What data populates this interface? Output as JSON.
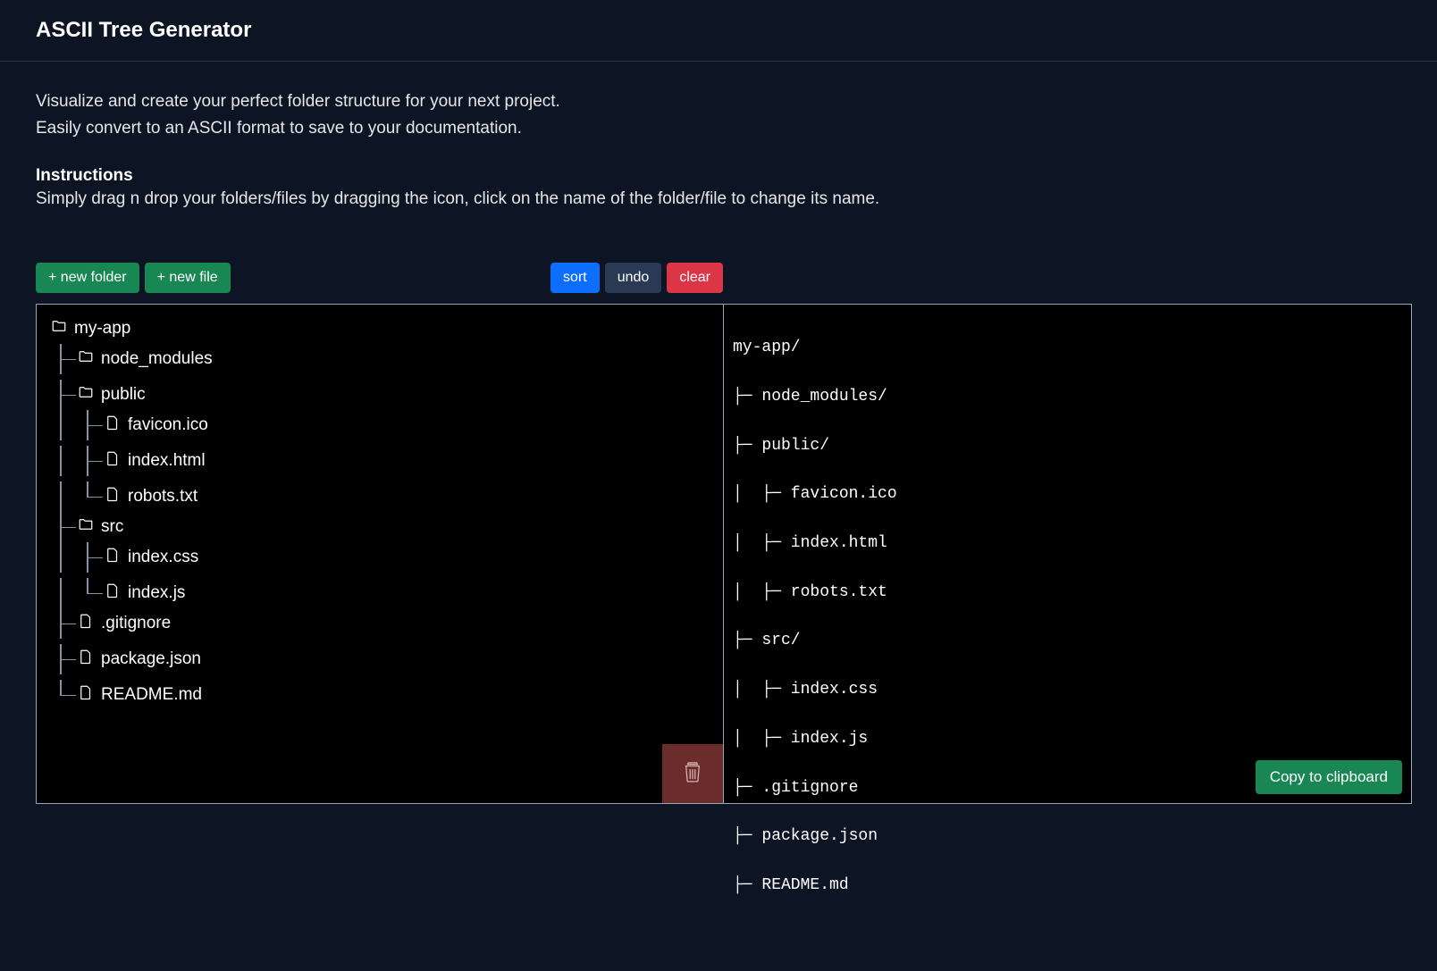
{
  "header": {
    "title": "ASCII Tree Generator"
  },
  "intro": {
    "line1": "Visualize and create your perfect folder structure for your next project.",
    "line2": "Easily convert to an ASCII format to save to your documentation.",
    "instructions_title": "Instructions",
    "instructions_body": "Simply drag n drop your folders/files by dragging the icon, click on the name of the folder/file to change its name."
  },
  "buttons": {
    "new_folder": "+ new folder",
    "new_file": "+ new file",
    "sort": "sort",
    "undo": "undo",
    "clear": "clear",
    "copy": "Copy to clipboard"
  },
  "tree": {
    "root": "my-app",
    "items": {
      "node_modules": "node_modules",
      "public": "public",
      "public_children": {
        "favicon": "favicon.ico",
        "index_html": "index.html",
        "robots": "robots.txt"
      },
      "src": "src",
      "src_children": {
        "index_css": "index.css",
        "index_js": "index.js"
      },
      "gitignore": ".gitignore",
      "package_json": "package.json",
      "readme": "README.md"
    }
  },
  "ascii_lines": [
    "my-app/",
    "├─ node_modules/",
    "├─ public/",
    "│  ├─ favicon.ico",
    "│  ├─ index.html",
    "│  ├─ robots.txt",
    "├─ src/",
    "│  ├─ index.css",
    "│  ├─ index.js",
    "├─ .gitignore",
    "├─ package.json",
    "├─ README.md"
  ]
}
